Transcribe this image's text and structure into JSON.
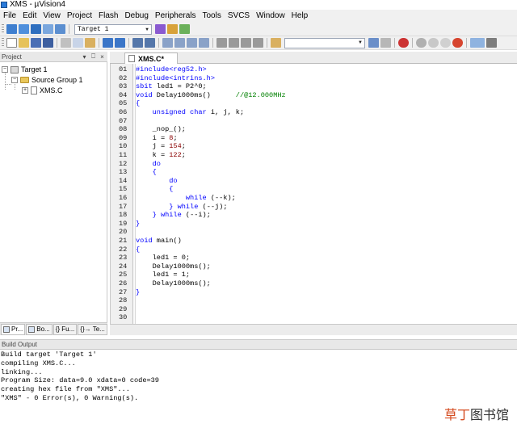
{
  "window": {
    "title": "XMS  - µVision4"
  },
  "menu": [
    "File",
    "Edit",
    "View",
    "Project",
    "Flash",
    "Debug",
    "Peripherals",
    "Tools",
    "SVCS",
    "Window",
    "Help"
  ],
  "toolbar": {
    "target_value": "Target 1"
  },
  "project_pane": {
    "title": "Project",
    "header_buttons": [
      "▾",
      "⎕",
      "×"
    ],
    "tree": [
      {
        "label": "Target 1",
        "expander": "−"
      },
      {
        "label": "Source Group 1",
        "expander": "−"
      },
      {
        "label": "XMS.C",
        "expander": "+"
      }
    ],
    "tabs": [
      "Pr...",
      "Bo...",
      "{} Fu...",
      "{}→ Te..."
    ]
  },
  "editor": {
    "tab_label": "XMS.C*",
    "lines": [
      {
        "n": "01",
        "code": [
          {
            "t": "#include<reg52.h>",
            "c": "pp"
          }
        ]
      },
      {
        "n": "02",
        "code": [
          {
            "t": "#include<intrins.h>",
            "c": "pp"
          }
        ]
      },
      {
        "n": "03",
        "code": [
          {
            "t": "sbit",
            "c": "kw"
          },
          {
            "t": " led1 = P2^0;",
            "c": ""
          }
        ]
      },
      {
        "n": "04",
        "code": [
          {
            "t": "void",
            "c": "kw"
          },
          {
            "t": " Delay1000ms()      ",
            "c": ""
          },
          {
            "t": "//@12.000MHz",
            "c": "cm"
          }
        ]
      },
      {
        "n": "05",
        "code": [
          {
            "t": "{",
            "c": "kw"
          }
        ]
      },
      {
        "n": "06",
        "code": [
          {
            "t": "    ",
            "c": ""
          },
          {
            "t": "unsigned char",
            "c": "kw"
          },
          {
            "t": " i, j, k;",
            "c": ""
          }
        ]
      },
      {
        "n": "07",
        "code": []
      },
      {
        "n": "08",
        "code": [
          {
            "t": "    _nop_();",
            "c": ""
          }
        ]
      },
      {
        "n": "09",
        "code": [
          {
            "t": "    i = ",
            "c": ""
          },
          {
            "t": "8",
            "c": "nm"
          },
          {
            "t": ";",
            "c": ""
          }
        ]
      },
      {
        "n": "10",
        "code": [
          {
            "t": "    j = ",
            "c": ""
          },
          {
            "t": "154",
            "c": "nm"
          },
          {
            "t": ";",
            "c": ""
          }
        ]
      },
      {
        "n": "11",
        "code": [
          {
            "t": "    k = ",
            "c": ""
          },
          {
            "t": "122",
            "c": "nm"
          },
          {
            "t": ";",
            "c": ""
          }
        ]
      },
      {
        "n": "12",
        "code": [
          {
            "t": "    ",
            "c": ""
          },
          {
            "t": "do",
            "c": "kw"
          }
        ]
      },
      {
        "n": "13",
        "code": [
          {
            "t": "    ",
            "c": ""
          },
          {
            "t": "{",
            "c": "kw"
          }
        ]
      },
      {
        "n": "14",
        "code": [
          {
            "t": "        ",
            "c": ""
          },
          {
            "t": "do",
            "c": "kw"
          }
        ]
      },
      {
        "n": "15",
        "code": [
          {
            "t": "        ",
            "c": ""
          },
          {
            "t": "{",
            "c": "kw"
          }
        ]
      },
      {
        "n": "16",
        "code": [
          {
            "t": "            ",
            "c": ""
          },
          {
            "t": "while",
            "c": "kw"
          },
          {
            "t": " (--k);",
            "c": ""
          }
        ]
      },
      {
        "n": "17",
        "code": [
          {
            "t": "        ",
            "c": ""
          },
          {
            "t": "} while",
            "c": "kw"
          },
          {
            "t": " (--j);",
            "c": ""
          }
        ]
      },
      {
        "n": "18",
        "code": [
          {
            "t": "    ",
            "c": ""
          },
          {
            "t": "} while",
            "c": "kw"
          },
          {
            "t": " (--i);",
            "c": ""
          }
        ]
      },
      {
        "n": "19",
        "code": [
          {
            "t": "}",
            "c": "kw"
          }
        ]
      },
      {
        "n": "20",
        "code": []
      },
      {
        "n": "21",
        "code": [
          {
            "t": "void",
            "c": "kw"
          },
          {
            "t": " main()",
            "c": ""
          }
        ]
      },
      {
        "n": "22",
        "code": [
          {
            "t": "{",
            "c": "kw"
          }
        ]
      },
      {
        "n": "23",
        "code": [
          {
            "t": "    led1 = 0;",
            "c": ""
          }
        ]
      },
      {
        "n": "24",
        "code": [
          {
            "t": "    Delay1000ms();",
            "c": ""
          }
        ]
      },
      {
        "n": "25",
        "code": [
          {
            "t": "    led1 = 1;",
            "c": ""
          }
        ]
      },
      {
        "n": "26",
        "code": [
          {
            "t": "    Delay1000ms();",
            "c": ""
          }
        ]
      },
      {
        "n": "27",
        "code": [
          {
            "t": "}",
            "c": "kw"
          }
        ]
      },
      {
        "n": "28",
        "code": []
      },
      {
        "n": "29",
        "code": []
      },
      {
        "n": "30",
        "code": []
      }
    ]
  },
  "build_output": {
    "title": "Build Output",
    "lines": [
      "Build target 'Target 1'",
      "compiling XMS.C...",
      "linking...",
      "Program Size: data=9.0 xdata=0 code=39",
      "creating hex file from \"XMS\"...",
      "\"XMS\" - 0 Error(s), 0 Warning(s)."
    ]
  },
  "watermark": {
    "part1": "草丁",
    "part2": "图书馆"
  }
}
